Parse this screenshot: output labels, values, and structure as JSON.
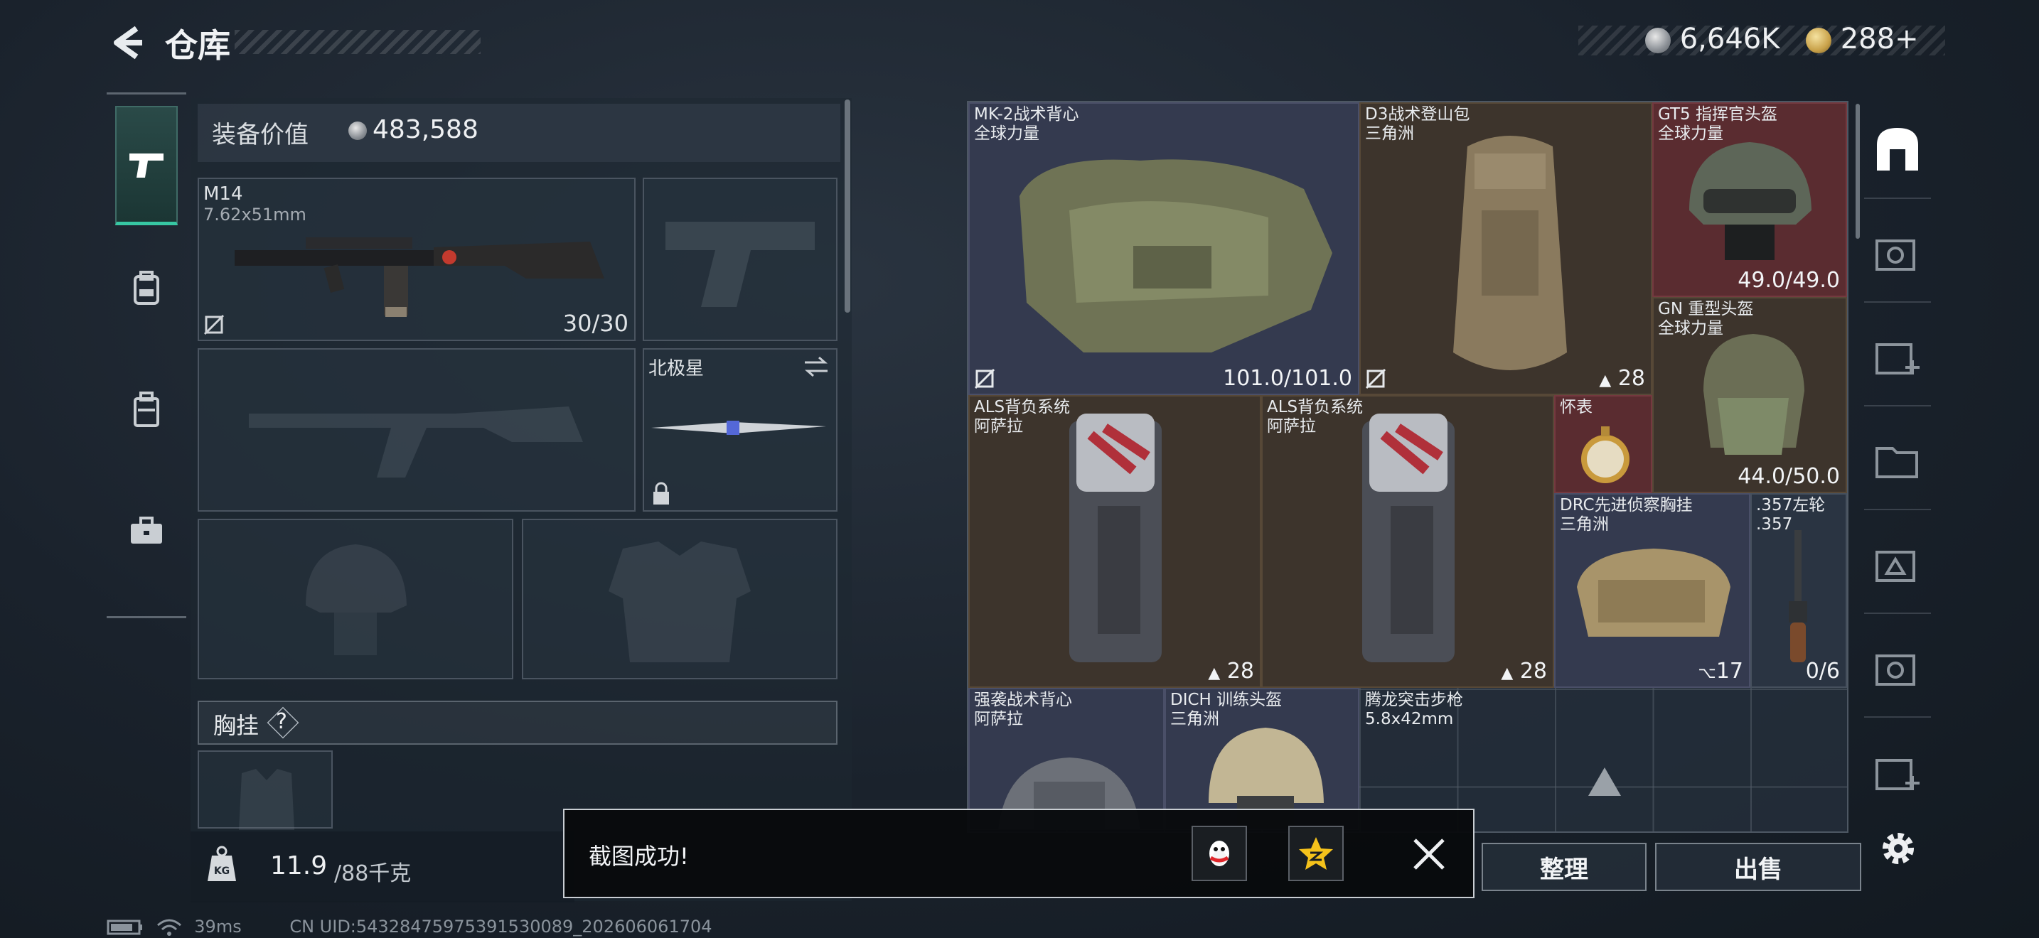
{
  "header": {
    "title": "仓库"
  },
  "currencies": [
    {
      "icon": "silver-coin-icon",
      "value": "6,646K"
    },
    {
      "icon": "gold-coin-icon",
      "value": "288",
      "plus": "+"
    }
  ],
  "left_tabs": [
    "pistol-icon",
    "rig-icon",
    "backpack-icon",
    "briefcase-icon"
  ],
  "equipment": {
    "value_label": "装备价值",
    "value": "483,588",
    "primary": {
      "name": "M14",
      "caliber": "7.62x51mm",
      "ammo": "30/30"
    },
    "melee": {
      "name": "北极星"
    },
    "chest_label": "胸挂",
    "chest_help": "?"
  },
  "weight": {
    "current": "11.9",
    "capacity": "/88千克"
  },
  "stash_items": [
    {
      "name": "MK-2战术背心",
      "sub": "全球力量",
      "count": "101.0/101.0"
    },
    {
      "name": "D3战术登山包",
      "sub": "三角洲",
      "count": "28"
    },
    {
      "name": "GT5 指挥官头盔",
      "sub": "全球力量",
      "count": "49.0/49.0"
    },
    {
      "name": "GN 重型头盔",
      "sub": "全球力量",
      "count": "44.0/50.0"
    },
    {
      "name": "ALS背负系统",
      "sub": "阿萨拉",
      "count": "28"
    },
    {
      "name": "ALS背负系统",
      "sub": "阿萨拉",
      "count": "28"
    },
    {
      "name": "怀表",
      "sub": "",
      "count": ""
    },
    {
      "name": "DRC先进侦察胸挂",
      "sub": "三角洲",
      "count": "17"
    },
    {
      "name": ".357左轮",
      "sub": ".357",
      "count": "0/6"
    },
    {
      "name": "强袭战术背心",
      "sub": "阿萨拉",
      "count": ""
    },
    {
      "name": "DICH 训练头盔",
      "sub": "三角洲",
      "count": ""
    },
    {
      "name": "腾龙突击步枪",
      "sub": "5.8x42mm",
      "count": ""
    }
  ],
  "actions": {
    "sort": "整理",
    "sell": "出售"
  },
  "toast": {
    "message": "截图成功!"
  },
  "footer": {
    "ping": "39ms",
    "uid": "CN UID:54328475975391530089_202606061704"
  }
}
